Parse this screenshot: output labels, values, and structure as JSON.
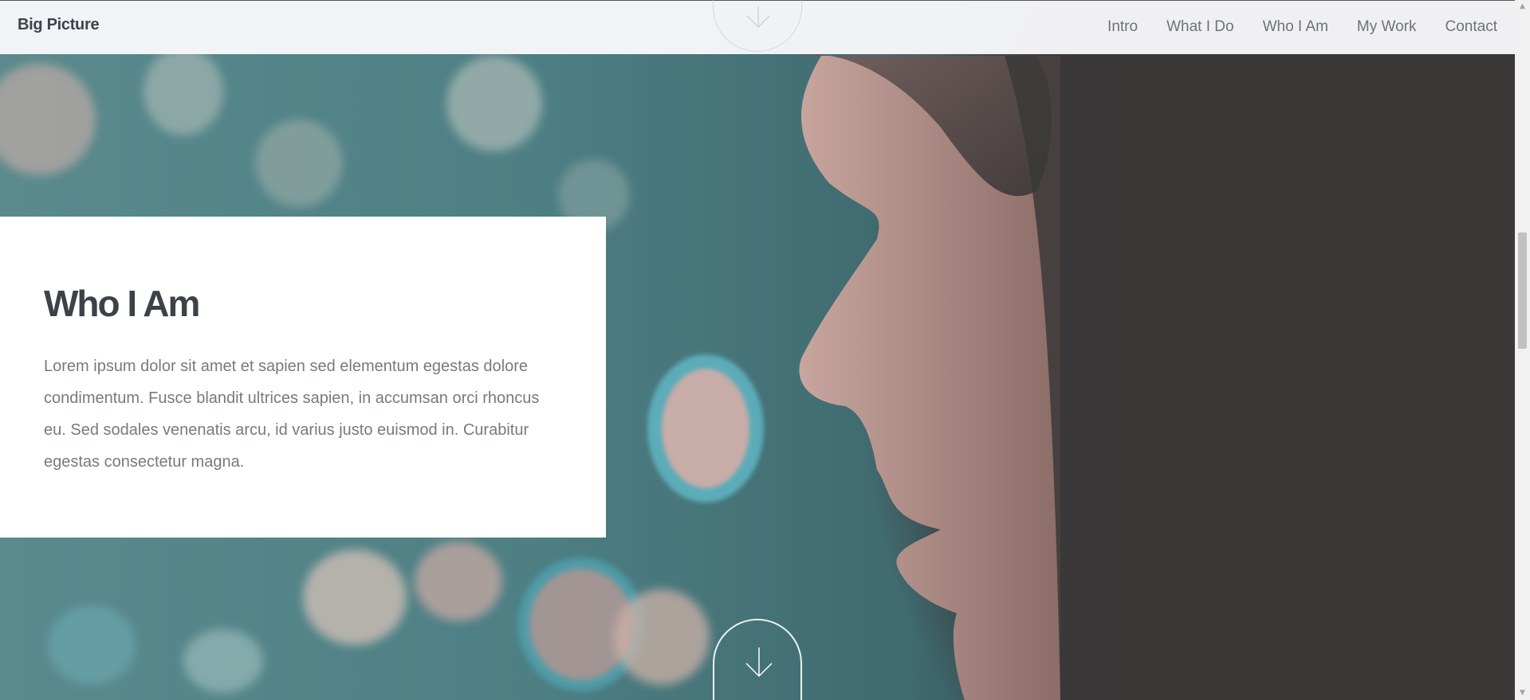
{
  "header": {
    "brand": "Big Picture",
    "nav": [
      "Intro",
      "What I Do",
      "Who I Am",
      "My Work",
      "Contact"
    ]
  },
  "section": {
    "title": "Who I Am",
    "body": "Lorem ipsum dolor sit amet et sapien sed elementum egestas dolore condimentum. Fusce blandit ultrices sapien, in accumsan orci rhoncus eu. Sed sodales venenatis arcu, id varius justo euismod in. Curabitur egestas consectetur magna."
  },
  "icons": {
    "scroll_down": "arrow-down-icon"
  },
  "colors": {
    "heading": "#3b4349",
    "body_text": "#757b80",
    "nav_text": "#6c7378",
    "card_bg": "#ffffff"
  },
  "scrollbar": {
    "position_fraction": 0.34
  }
}
